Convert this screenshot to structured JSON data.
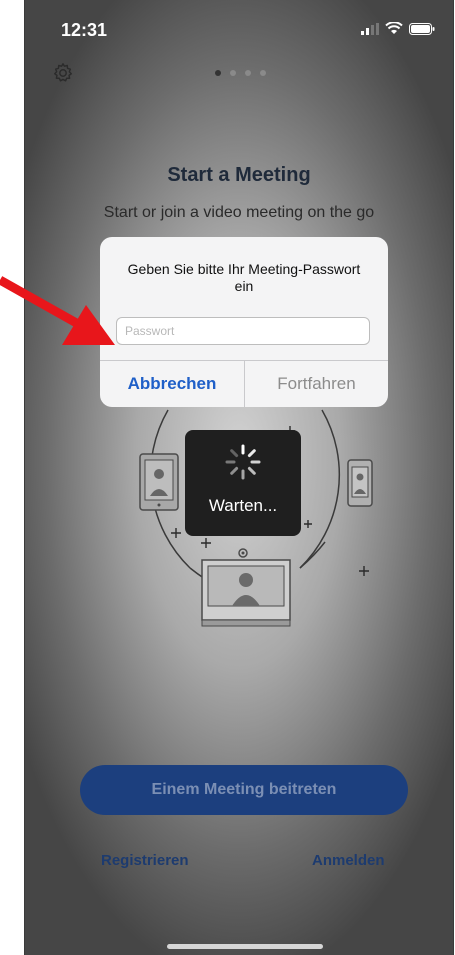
{
  "status_bar": {
    "time": "12:31"
  },
  "page": {
    "title": "Start a Meeting",
    "subtitle": "Start or join a video meeting on the go"
  },
  "dialog": {
    "message": "Geben Sie bitte Ihr Meeting-Passwort ein",
    "input_placeholder": "Passwort",
    "input_value": "",
    "cancel_label": "Abbrechen",
    "continue_label": "Fortfahren"
  },
  "loader": {
    "text": "Warten..."
  },
  "actions": {
    "join_label": "Einem Meeting beitreten",
    "register_label": "Registrieren",
    "login_label": "Anmelden"
  },
  "colors": {
    "accent_blue": "#1f5fc8",
    "join_button": "#1c3f7e",
    "annotation_arrow": "#e8161b"
  },
  "icons": [
    "gear-icon",
    "signal-icon",
    "wifi-icon",
    "battery-icon",
    "spinner-icon",
    "tablet-icon",
    "phone-icon",
    "monitor-icon"
  ]
}
